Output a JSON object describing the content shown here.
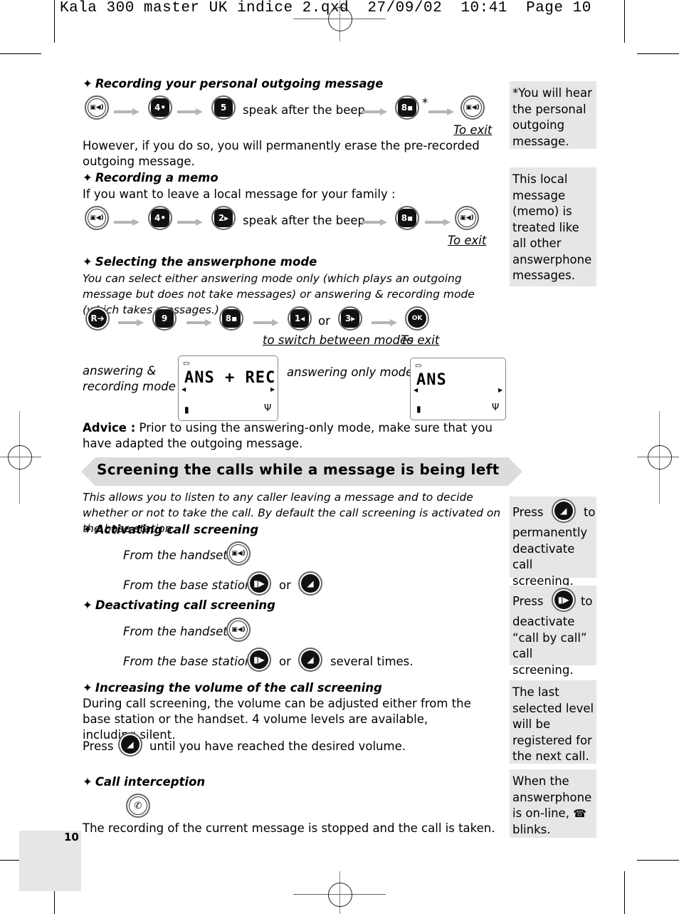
{
  "slug": "Kala 300 master UK indice 2.qxd  27/09/02  10:41  Page 10",
  "sections": {
    "outgoing": {
      "heading": "Recording your personal outgoing message",
      "keys": [
        "answerphone-key",
        "4 GHI",
        "5 JKL"
      ],
      "speak": "speak after the beep",
      "key_after": "8 TUV",
      "asterisk": "*",
      "exit_label": "To exit",
      "note": "However, if you do so, you will permanently erase the pre-recorded outgoing message."
    },
    "memo": {
      "heading": "Recording a memo",
      "intro": "If you want to leave a local message for your family :",
      "keys": [
        "answerphone-key",
        "4 GHI",
        "2 ABC"
      ],
      "speak": "speak after the beep",
      "key_after": "8 TUV",
      "exit_label": "To exit"
    },
    "mode": {
      "heading": "Selecting the answerphone mode",
      "description": "You can select either answering mode only (which plays an outgoing message but does not take messages) or answering & recording mode (which takes messages.)",
      "keys": [
        "R",
        "9 WXYZ",
        "8 TUV",
        "1",
        "3 DEF",
        "OK"
      ],
      "or": "or",
      "switch_label": "to switch between modes",
      "exit_label": "To exit",
      "mode1_label_line1": "answering &",
      "mode1_label_line2": "recording mode",
      "mode1_display": "ANS + REC",
      "mode2_label": "answering only mode",
      "mode2_display": "ANS",
      "advice_label": "Advice :",
      "advice_text": " Prior to using the answering-only mode, make sure that you have adapted the outgoing message."
    },
    "screening": {
      "banner": "Screening the calls while a message is being left",
      "intro": "This allows you to listen to any caller leaving a message and to decide whether or not to take the call. By default the call screening is activated on the base station.",
      "activate": {
        "heading": "Activating call screening",
        "handset": "From the handset :",
        "base": "From the base station :",
        "or": "or"
      },
      "deactivate": {
        "heading": "Deactivating call screening",
        "handset": "From the handset :",
        "base": "From the base station :",
        "or": "or",
        "suffix": "several times."
      },
      "volume": {
        "heading": "Increasing the volume of the call screening",
        "text": "During call screening, the volume can be adjusted either from the base station or the handset. 4 volume levels are available, including silent.",
        "press": "Press",
        "press_suffix": "until you have reached the desired volume."
      },
      "intercept": {
        "heading": "Call interception",
        "text": "The recording of the current message is stopped and the call is taken."
      }
    }
  },
  "sidebar": {
    "note1": "*You will hear the personal outgoing message.",
    "note2": "This local message (memo) is treated like all other answerphone messages.",
    "note3_press": "Press",
    "note3_rest": "to permanently deactivate call screening.",
    "note4_press": "Press",
    "note4_rest": "to deactivate “call by call” call screening.",
    "note5": "The last selected level will be registered for the next call.",
    "note6_a": "When the answerphone is on-line,",
    "note6_b": "blinks."
  },
  "page_number": "10"
}
